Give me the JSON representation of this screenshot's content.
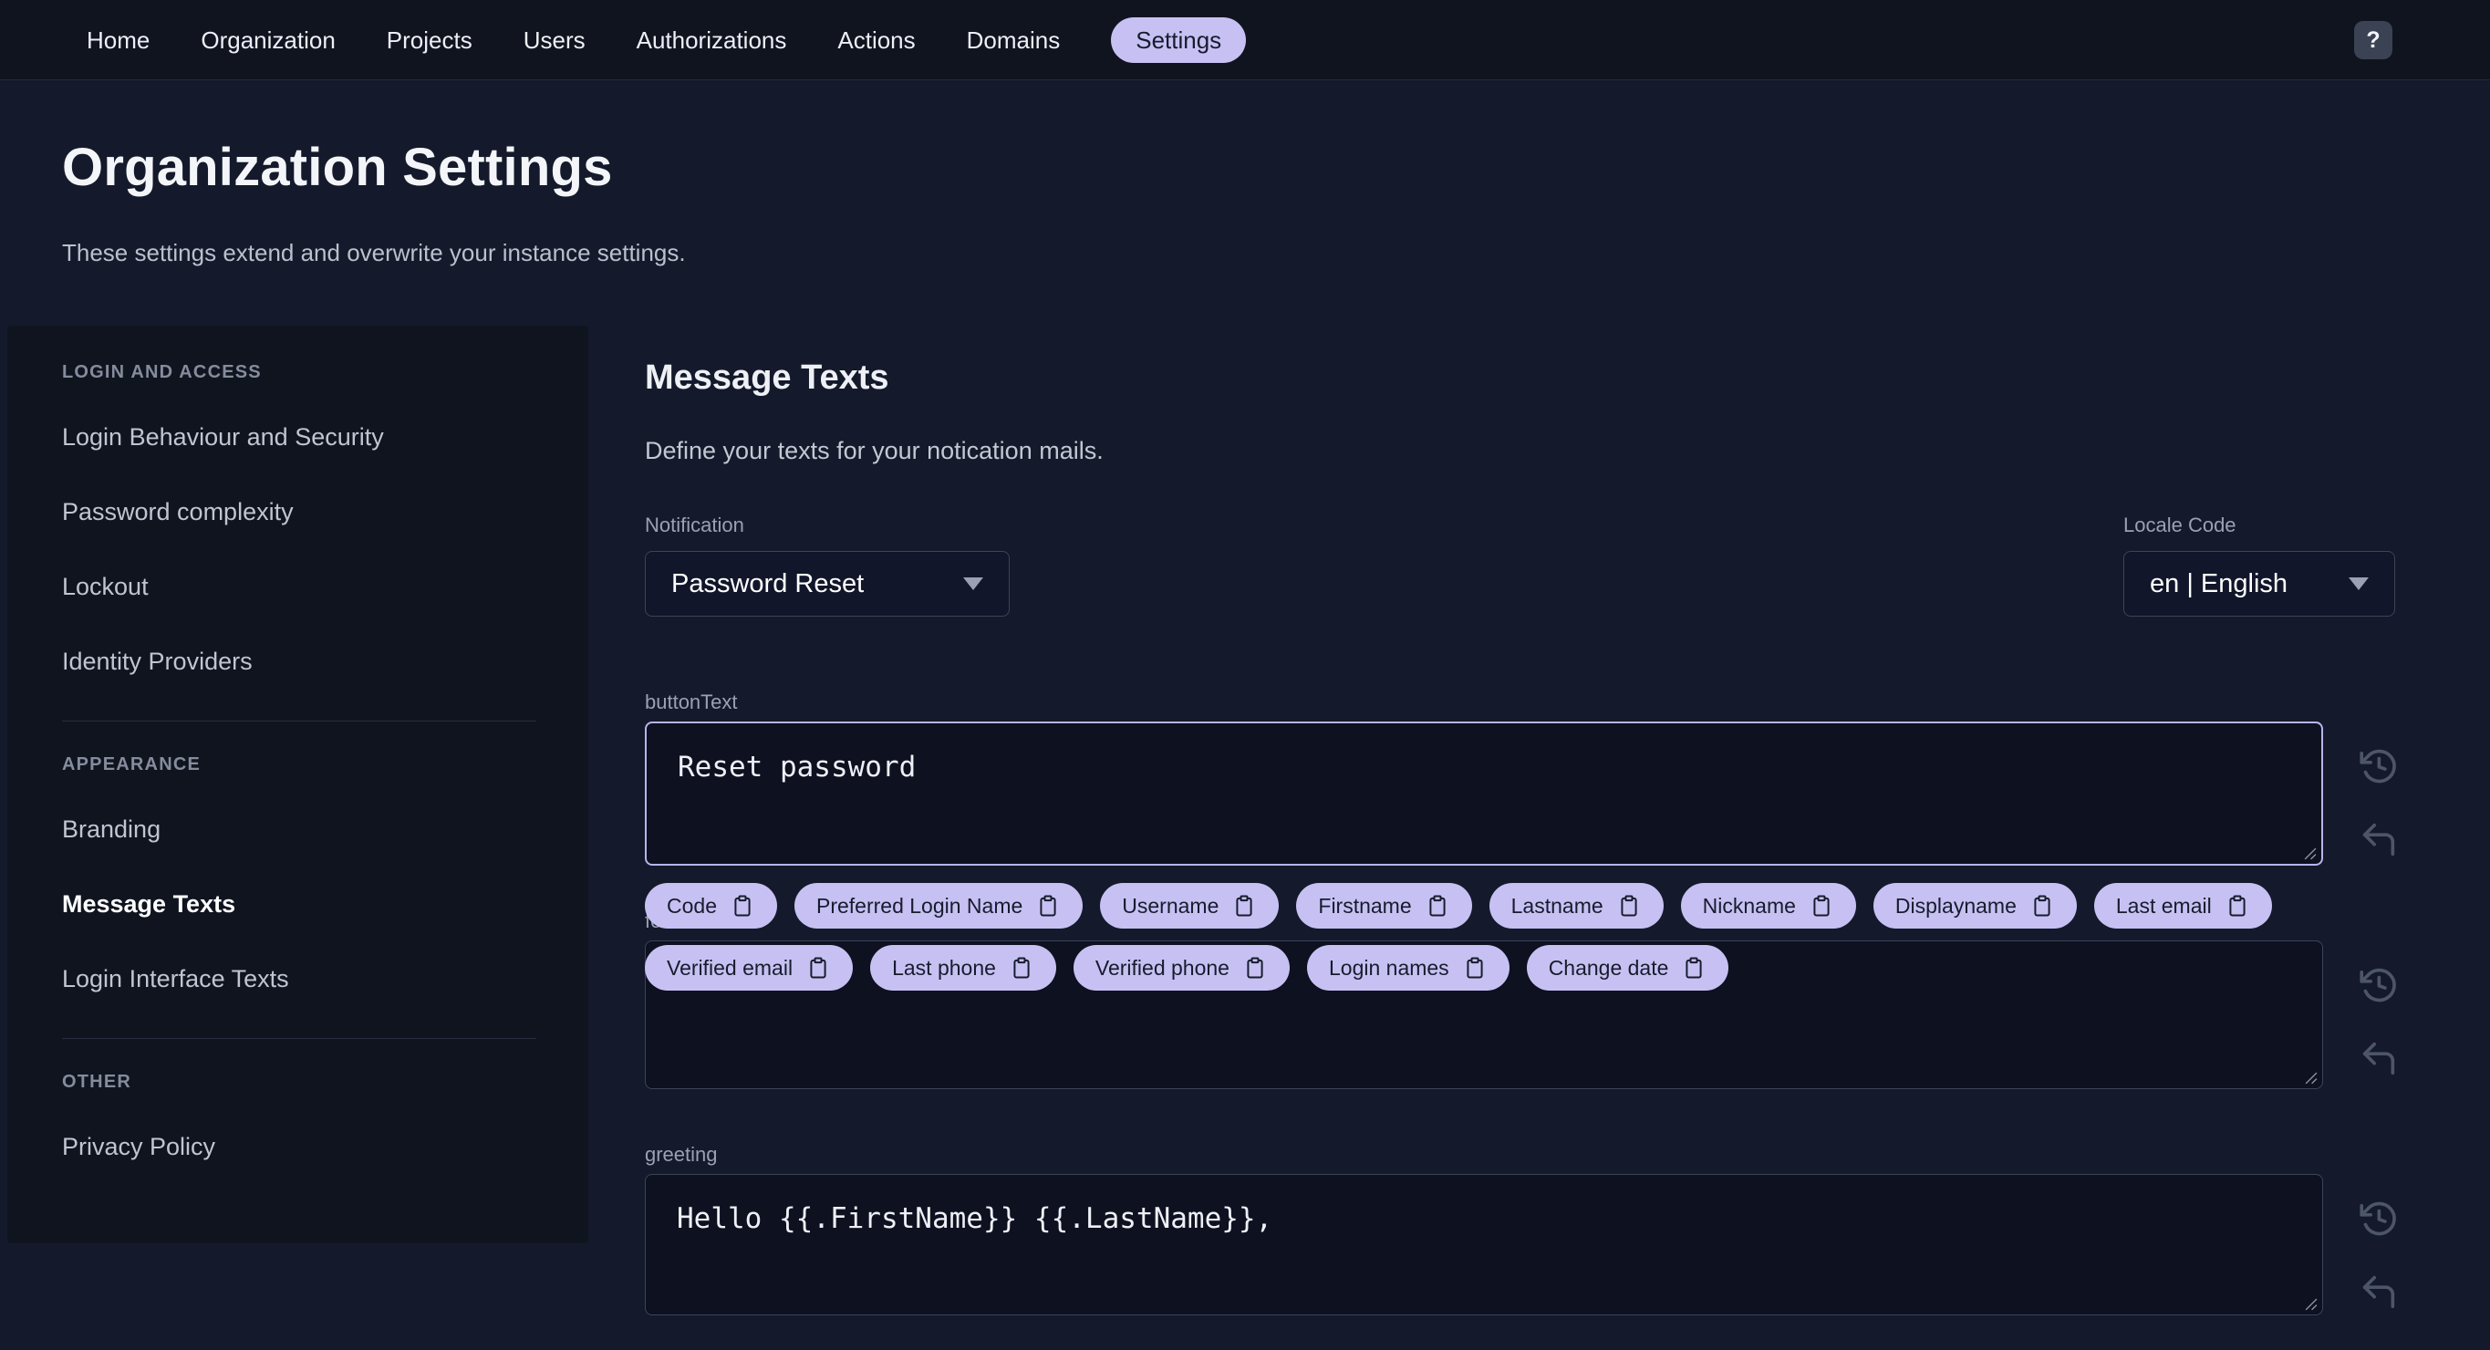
{
  "nav": {
    "items": [
      "Home",
      "Organization",
      "Projects",
      "Users",
      "Authorizations",
      "Actions",
      "Domains",
      "Settings"
    ],
    "active": "Settings",
    "help_label": "?"
  },
  "header": {
    "title": "Organization Settings",
    "subtitle": "These settings extend and overwrite your instance settings."
  },
  "sidebar": {
    "active_item": "Message Texts",
    "sections": [
      {
        "header": "LOGIN AND ACCESS",
        "items": [
          "Login Behaviour and Security",
          "Password complexity",
          "Lockout",
          "Identity Providers"
        ]
      },
      {
        "header": "APPEARANCE",
        "items": [
          "Branding",
          "Message Texts",
          "Login Interface Texts"
        ]
      },
      {
        "header": "OTHER",
        "items": [
          "Privacy Policy"
        ]
      }
    ]
  },
  "main": {
    "title": "Message Texts",
    "description": "Define your texts for your notication mails.",
    "notification": {
      "label": "Notification",
      "value": "Password Reset"
    },
    "locale": {
      "label": "Locale Code",
      "value": "en | English"
    },
    "fields": [
      {
        "key": "buttonText",
        "label": "buttonText",
        "value": "Reset password",
        "focused": true
      },
      {
        "key": "footerText",
        "label": "footerText",
        "value": "",
        "focused": false
      },
      {
        "key": "greeting",
        "label": "greeting",
        "value": "Hello {{.FirstName}} {{.LastName}},",
        "focused": false
      }
    ],
    "field_action_icons": [
      "history-icon",
      "undo-icon"
    ],
    "chips": [
      "Code",
      "Preferred Login Name",
      "Username",
      "Firstname",
      "Lastname",
      "Nickname",
      "Displayname",
      "Last email",
      "Verified email",
      "Last phone",
      "Verified phone",
      "Login names",
      "Change date"
    ],
    "chip_icon": "clipboard-icon"
  },
  "colors": {
    "accent": "#c7c1f3",
    "accent_border": "#b9b3ee",
    "page_background": "#141a2b",
    "panel_background": "#10141f",
    "input_background": "#0d1120",
    "input_border": "#3d4456",
    "icon_gray": "#4d5568"
  }
}
